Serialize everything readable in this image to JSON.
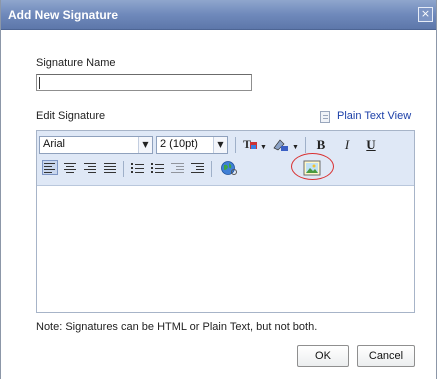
{
  "dialog": {
    "title": "Add New Signature",
    "close_glyph": "×"
  },
  "form": {
    "signature_name_label": "Signature Name",
    "signature_name_value": "",
    "edit_signature_label": "Edit Signature",
    "plain_text_view": "Plain Text View"
  },
  "toolbar": {
    "font_family": "Arial",
    "font_size": "2 (10pt)",
    "bold": "B",
    "italic": "I",
    "underline": "U",
    "text_color_icon": "text-color-icon",
    "highlight_icon": "highlight-color-icon",
    "insert_link_icon": "insert-link-globe-icon",
    "insert_image_icon": "insert-image-icon",
    "highlight_ring_color": "#d93030"
  },
  "footer": {
    "note": "Note: Signatures can be HTML or Plain Text, but not both.",
    "ok_label": "OK",
    "cancel_label": "Cancel"
  }
}
